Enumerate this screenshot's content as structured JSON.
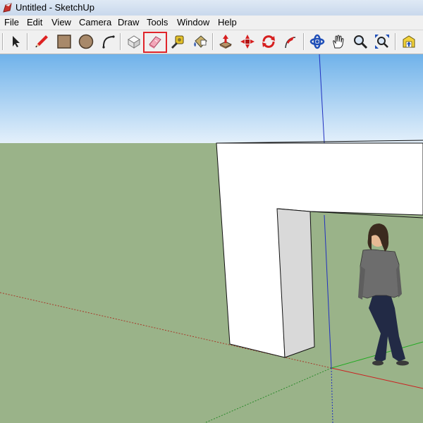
{
  "window": {
    "title": "Untitled - SketchUp"
  },
  "menu": [
    "File",
    "Edit",
    "View",
    "Camera",
    "Draw",
    "Tools",
    "Window",
    "Help"
  ],
  "toolbar": {
    "tools": [
      {
        "name": "select-tool",
        "icon": "arrow-icon"
      },
      {
        "name": "pencil-tool",
        "icon": "pencil-icon"
      },
      {
        "name": "rectangle-tool",
        "icon": "rectangle-icon"
      },
      {
        "name": "circle-tool",
        "icon": "circle-icon"
      },
      {
        "name": "arc-tool",
        "icon": "arc-icon"
      },
      {
        "name": "make-component-tool",
        "icon": "component-icon"
      },
      {
        "name": "eraser-tool",
        "icon": "eraser-icon",
        "highlighted": true
      },
      {
        "name": "tape-measure-tool",
        "icon": "tape-measure-icon"
      },
      {
        "name": "paint-bucket-tool",
        "icon": "paint-bucket-icon"
      },
      {
        "name": "push-pull-tool",
        "icon": "push-pull-icon"
      },
      {
        "name": "move-tool",
        "icon": "move-icon"
      },
      {
        "name": "rotate-tool",
        "icon": "rotate-icon"
      },
      {
        "name": "follow-me-tool",
        "icon": "follow-me-icon"
      },
      {
        "name": "orbit-tool",
        "icon": "orbit-icon"
      },
      {
        "name": "pan-tool",
        "icon": "hand-icon"
      },
      {
        "name": "zoom-tool",
        "icon": "magnifier-icon"
      },
      {
        "name": "zoom-extents-tool",
        "icon": "zoom-extents-icon"
      },
      {
        "name": "get-models-tool",
        "icon": "warehouse-icon"
      }
    ],
    "highlight_color": "#e0242a"
  },
  "scene": {
    "sky_top": "#6fb2ea",
    "sky_bottom": "#e6f1fb",
    "ground": "#9ab389",
    "axis_red": "#cc2020",
    "axis_green": "#22aa22",
    "axis_blue": "#2030c0",
    "figure": "woman-figure"
  }
}
